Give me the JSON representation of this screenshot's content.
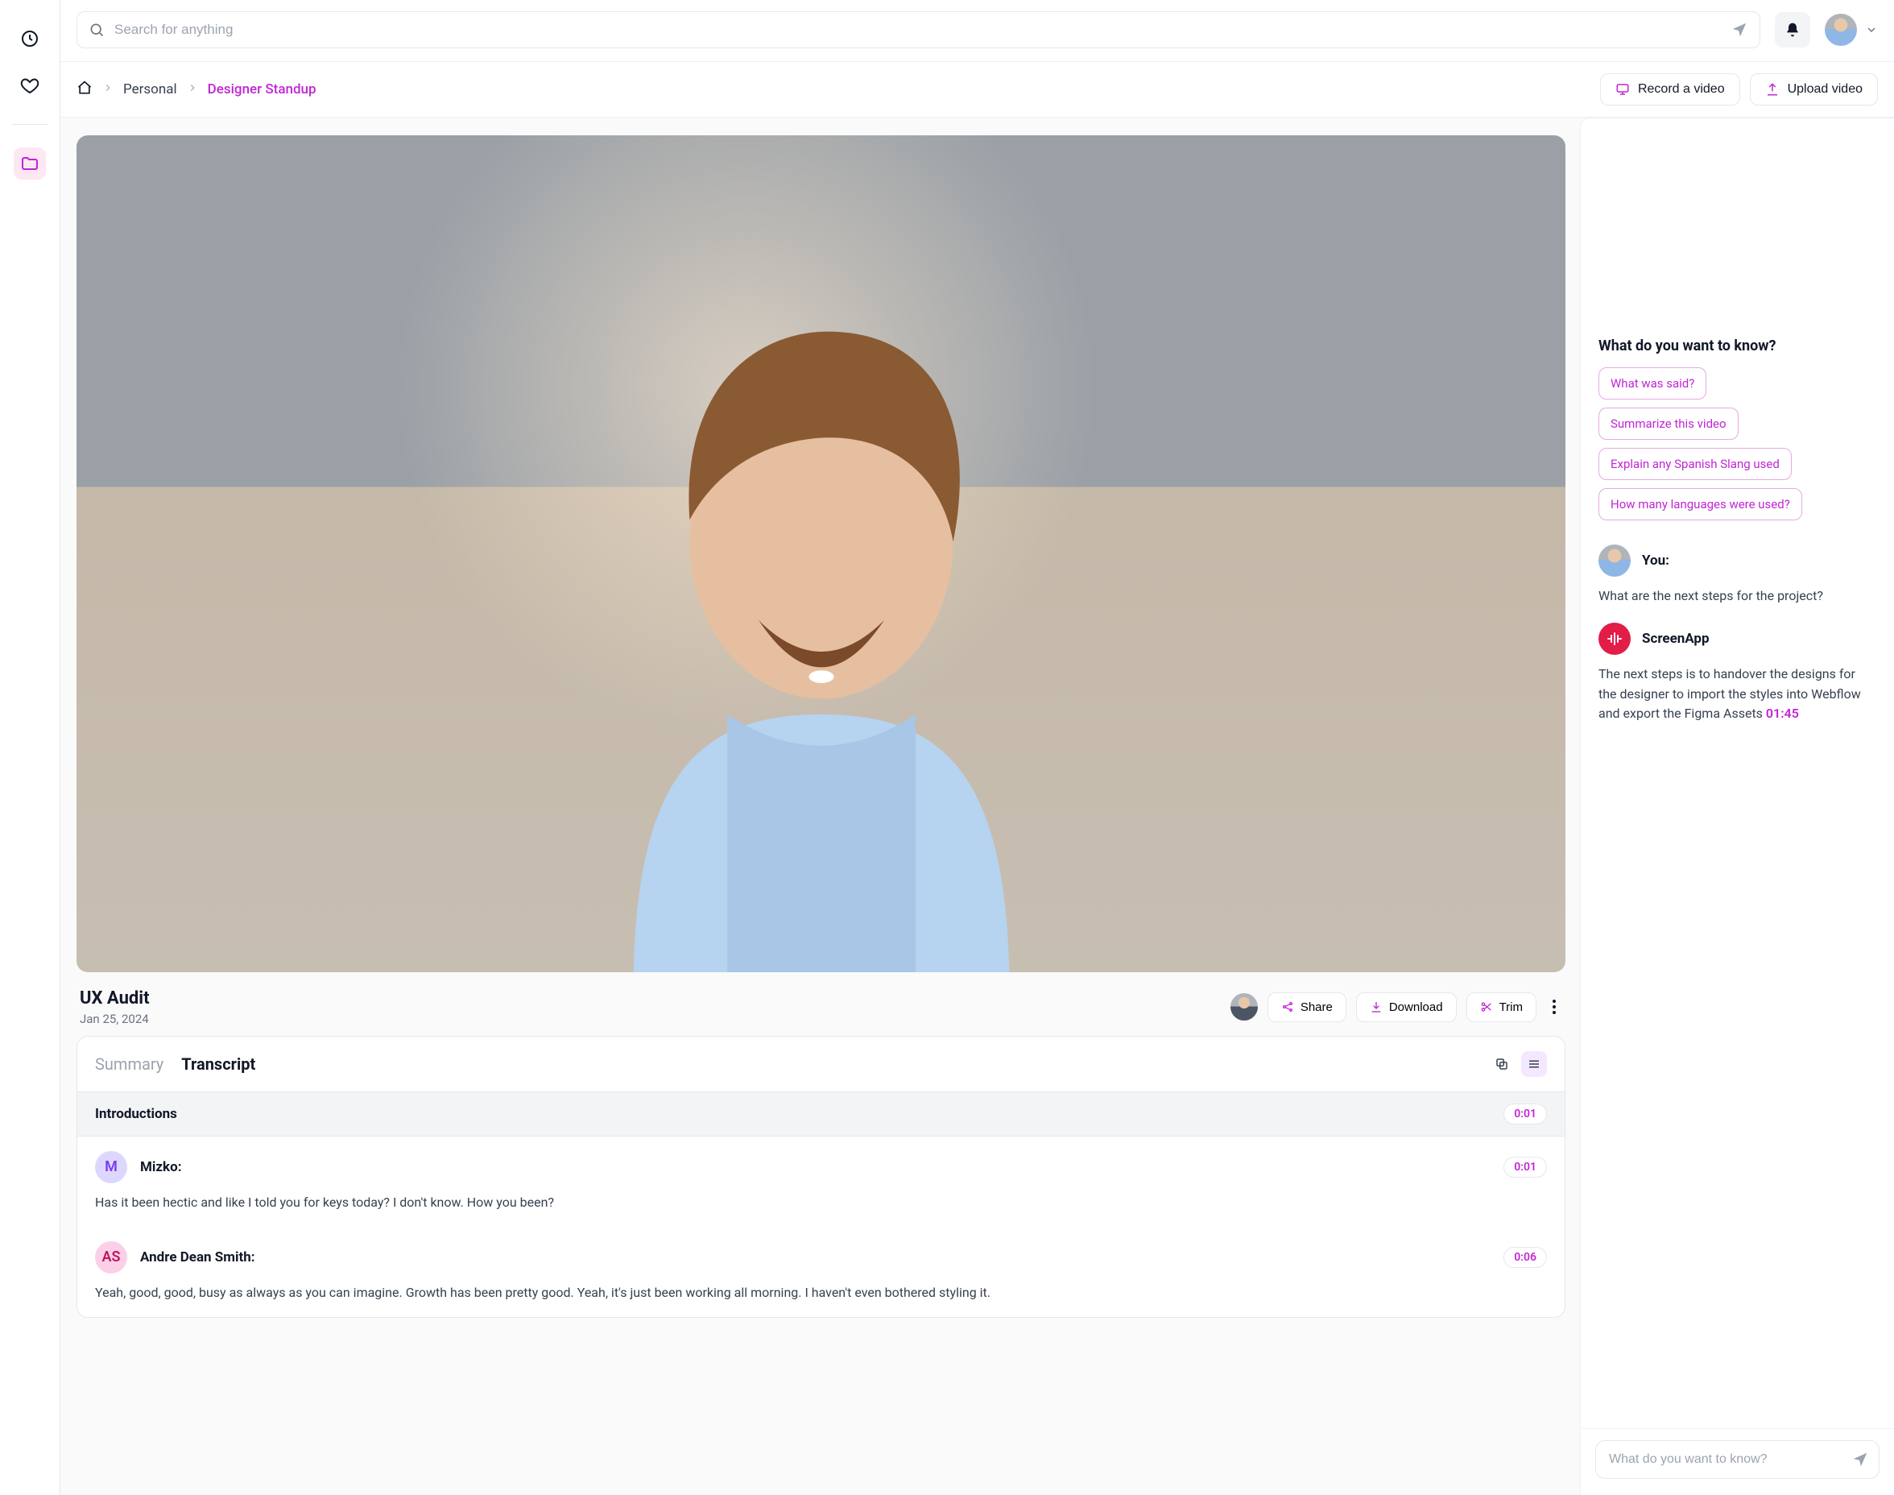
{
  "search": {
    "placeholder": "Search for anything"
  },
  "breadcrumb": {
    "personal": "Personal",
    "current": "Designer Standup"
  },
  "actions": {
    "record": "Record a video",
    "upload": "Upload video"
  },
  "video": {
    "title": "UX Audit",
    "date": "Jan 25, 2024"
  },
  "tools": {
    "share": "Share",
    "download": "Download",
    "trim": "Trim"
  },
  "tabs": {
    "summary": "Summary",
    "transcript": "Transcript"
  },
  "section": {
    "title": "Introductions",
    "time": "0:01"
  },
  "entries": [
    {
      "badge": "M",
      "who": "Mizko:",
      "time": "0:01",
      "line": "Has it been hectic and like I told you for keys today? I don't know. How you been?"
    },
    {
      "badge": "AS",
      "who": "Andre Dean Smith:",
      "time": "0:06",
      "line": "Yeah, good, good, busy as always as you can imagine. Growth has been pretty good. Yeah, it's just been working all morning. I haven't even bothered styling it."
    }
  ],
  "chat": {
    "ask_title": "What do you want to know?",
    "suggestions": [
      "What was said?",
      "Summarize this video",
      "Explain any Spanish Slang used",
      "How many languages were used?"
    ],
    "you_label": "You:",
    "you_msg": "What are the next steps for the project?",
    "app_label": "ScreenApp",
    "app_msg": "The next steps is to handover the designs for the designer to import the styles into Webflow and export the Figma Assets ",
    "app_ts": "01:45",
    "input_placeholder": "What do you want to know?"
  }
}
